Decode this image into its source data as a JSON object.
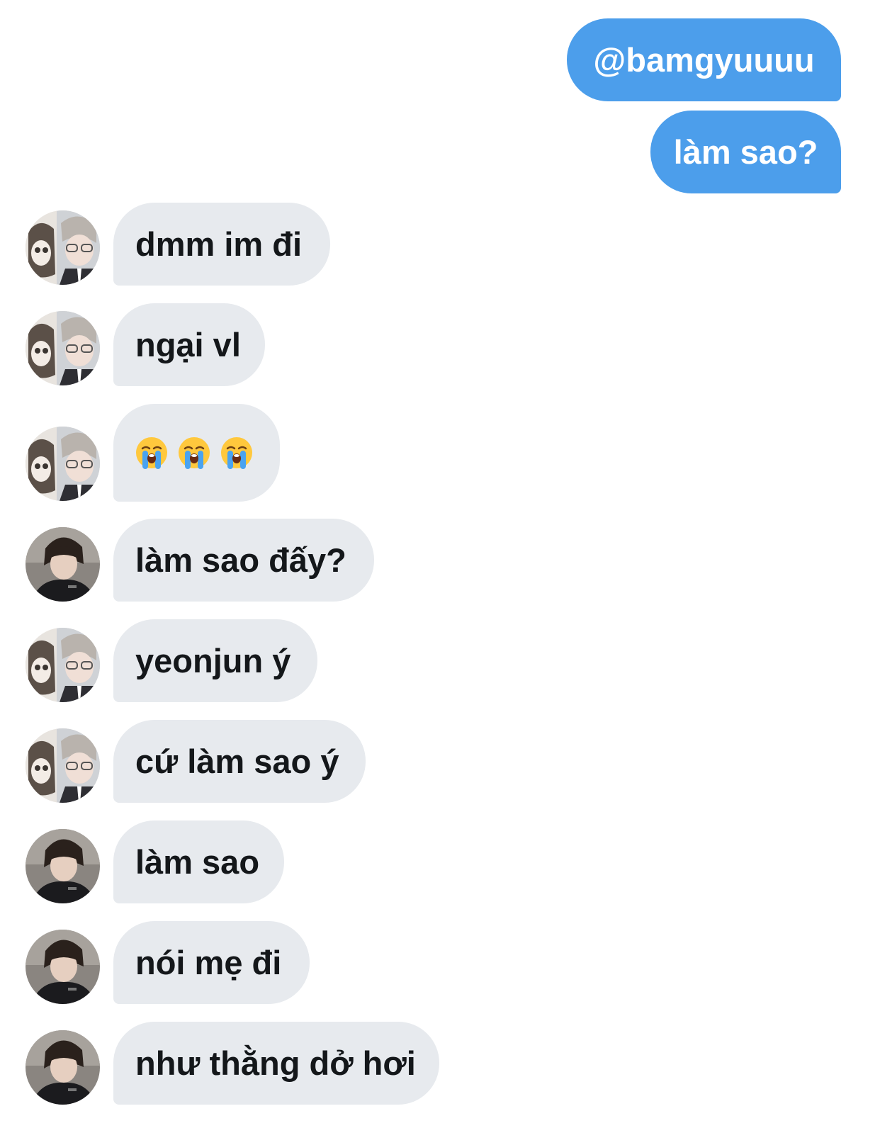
{
  "conversation": {
    "outgoing": [
      {
        "text": "@bamgyuuuu"
      },
      {
        "text": "làm sao?"
      }
    ],
    "incoming": [
      {
        "sender": "user-a",
        "text": "dmm im đi"
      },
      {
        "sender": "user-a",
        "text": "ngại vl"
      },
      {
        "sender": "user-a",
        "emoji": [
          "loudly-crying-face",
          "loudly-crying-face",
          "loudly-crying-face"
        ]
      },
      {
        "sender": "user-b",
        "text": "làm sao đấy?"
      },
      {
        "sender": "user-a",
        "text": "yeonjun ý"
      },
      {
        "sender": "user-a",
        "text": "cứ làm sao ý"
      },
      {
        "sender": "user-b",
        "text": "làm sao"
      },
      {
        "sender": "user-b",
        "text": "nói mẹ đi"
      },
      {
        "sender": "user-b",
        "text": "như thằng dở hơi"
      }
    ]
  },
  "colors": {
    "outgoing_bubble": "#4c9eeb",
    "incoming_bubble": "#e7eaee",
    "incoming_text": "#14171a",
    "background": "#ffffff"
  }
}
